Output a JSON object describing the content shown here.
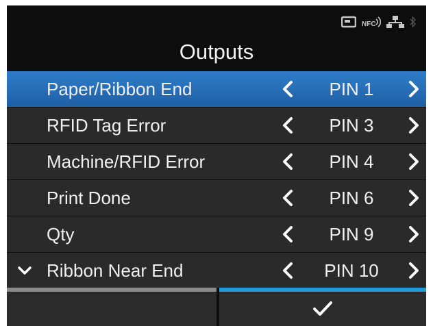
{
  "header": {
    "title": "Outputs",
    "status_icons": [
      "card-reader-icon",
      "nfc-icon",
      "network-icon",
      "bluetooth-icon"
    ],
    "nfc_label": "NFC"
  },
  "colors": {
    "background": "#0d0d0d",
    "row": "#2a2a2a",
    "selected_row": "#2f7dc8",
    "confirm_accent": "#1e9ad6",
    "cancel_accent": "#8a8a8a",
    "text": "#f0f0f0"
  },
  "list": {
    "items": [
      {
        "label": "Paper/Ribbon End",
        "value": "PIN 1"
      },
      {
        "label": "RFID Tag Error",
        "value": "PIN 3"
      },
      {
        "label": "Machine/RFID Error",
        "value": "PIN 4"
      },
      {
        "label": "Print Done",
        "value": "PIN 6"
      },
      {
        "label": "Qty",
        "value": "PIN 9"
      },
      {
        "label": "Ribbon Near End",
        "value": "PIN 10"
      }
    ]
  },
  "footer": {
    "confirm_icon": "check-icon"
  }
}
